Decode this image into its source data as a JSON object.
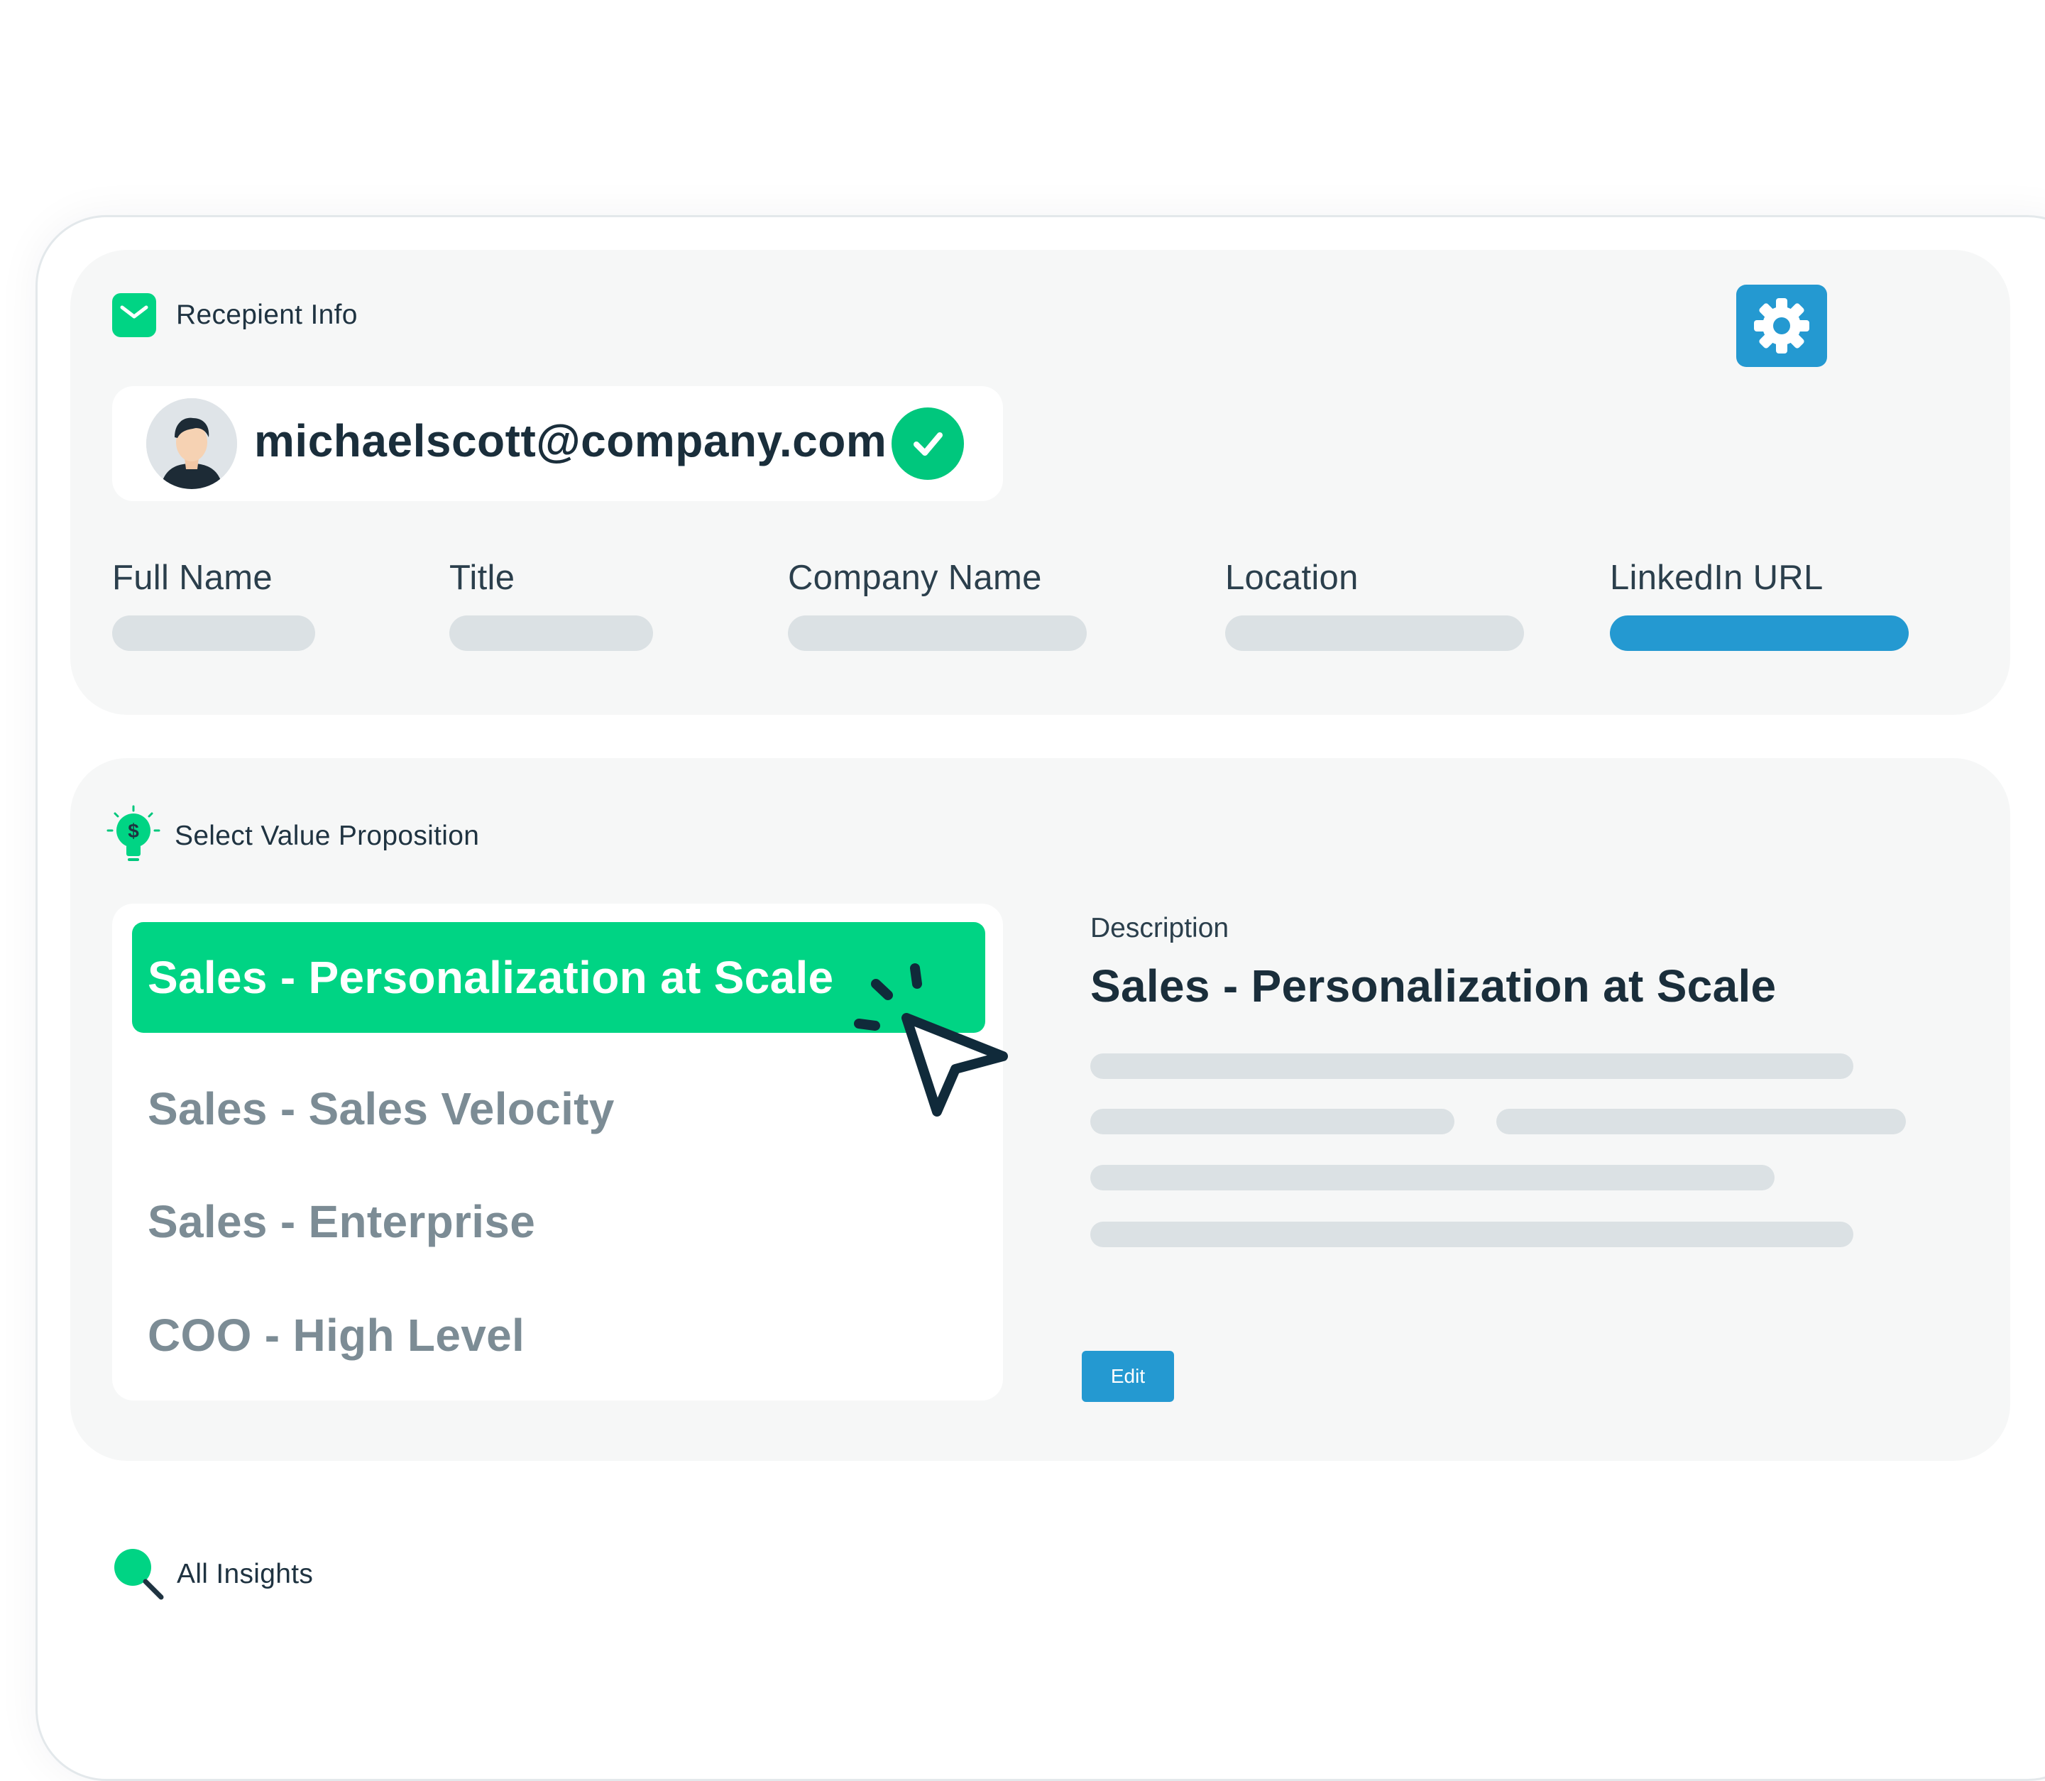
{
  "recipient_section": {
    "title": "Recepient Info",
    "email": "michaelscott@company.com",
    "fields": [
      {
        "label": "Full Name"
      },
      {
        "label": "Title"
      },
      {
        "label": "Company Name"
      },
      {
        "label": "Location"
      },
      {
        "label": "LinkedIn URL"
      }
    ]
  },
  "value_section": {
    "title": "Select Value Proposition",
    "items": [
      {
        "label": "Sales - Personalization at Scale"
      },
      {
        "label": "Sales - Sales Velocity"
      },
      {
        "label": "Sales - Enterprise"
      },
      {
        "label": "COO - High Level"
      }
    ],
    "description_label": "Description",
    "description_title": "Sales - Personalization at Scale",
    "edit_label": "Edit"
  },
  "insights_section": {
    "title": "All Insights"
  },
  "icons": {
    "recipient": "mail-icon",
    "settings": "gear-icon",
    "verified": "check-icon",
    "value": "lightbulb-dollar-icon",
    "insights": "magnifier-icon",
    "pointer": "cursor-icon"
  },
  "colors": {
    "accent_green": "#00d484",
    "accent_blue": "#2499d1",
    "panel_bg": "#f6f7f7",
    "placeholder_bar": "#dbe1e4",
    "text_dark": "#1a2e3b",
    "text_muted": "#7c8c95"
  }
}
